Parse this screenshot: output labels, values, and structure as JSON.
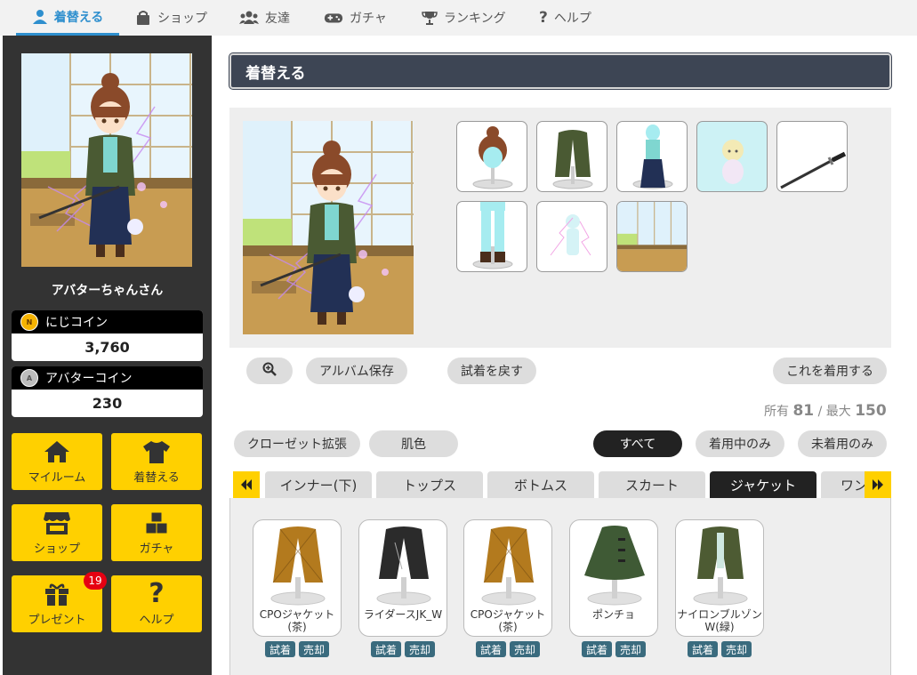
{
  "nav": [
    {
      "label": "着替える",
      "icon": "user-icon"
    },
    {
      "label": "ショップ",
      "icon": "bag-icon"
    },
    {
      "label": "友達",
      "icon": "friends-icon"
    },
    {
      "label": "ガチャ",
      "icon": "gamepad-icon"
    },
    {
      "label": "ランキング",
      "icon": "trophy-icon"
    },
    {
      "label": "ヘルプ",
      "icon": "question-icon"
    }
  ],
  "sidebar": {
    "user_name": "アバターちゃんさん",
    "coins": [
      {
        "label": "にじコイン",
        "value": "3,760",
        "badge": "nijicoin-icon",
        "color": "#f5b301"
      },
      {
        "label": "アバターコイン",
        "value": "230",
        "badge": "avatarcoin-icon",
        "color": "#bdbdbd"
      }
    ],
    "buttons": [
      {
        "label": "マイルーム",
        "icon": "home-icon"
      },
      {
        "label": "着替える",
        "icon": "tshirt-icon"
      },
      {
        "label": "ショップ",
        "icon": "shop-icon"
      },
      {
        "label": "ガチャ",
        "icon": "boxes-icon"
      },
      {
        "label": "プレゼント",
        "icon": "gift-icon"
      },
      {
        "label": "ヘルプ",
        "icon": "question-icon"
      }
    ],
    "present_badge": "19"
  },
  "page_title": "着替える",
  "equipped_thumbs": [
    "hair",
    "jacket",
    "hakama",
    "pet",
    "sword",
    "pants-boots",
    "effect",
    "background"
  ],
  "actions": {
    "zoom_label": "",
    "album_save": "アルバム保存",
    "undo_tryon": "試着を戻す",
    "wear_this": "これを着用する"
  },
  "owned": {
    "owned_label": "所有",
    "owned_count": "81",
    "separator": "/",
    "max_label": "最大",
    "max_count": "150"
  },
  "filters": {
    "closet_expand": "クローゼット拡張",
    "skin_color": "肌色",
    "all": "すべて",
    "wearing": "着用中のみ",
    "not_wearing": "未着用のみ"
  },
  "tabs": [
    "インナー(下)",
    "トップス",
    "ボトムス",
    "スカート",
    "ジャケット",
    "ワンピ"
  ],
  "active_tab": "ジャケット",
  "items": [
    {
      "name": "CPOジャケット(茶)",
      "color": "#b37a1e",
      "try": "試着",
      "sell": "売却"
    },
    {
      "name": "ライダースJK_W",
      "color": "#2b2b2b",
      "try": "試着",
      "sell": "売却"
    },
    {
      "name": "CPOジャケット(茶)",
      "color": "#b37a1e",
      "try": "試着",
      "sell": "売却"
    },
    {
      "name": "ポンチョ",
      "color": "#3f5a35",
      "try": "試着",
      "sell": "売却"
    },
    {
      "name": "ナイロンブルゾンW(緑)",
      "color": "#4d5b33",
      "try": "試着",
      "sell": "売却"
    }
  ],
  "colors": {
    "accent": "#ffd000",
    "nav_active": "#2e8fce",
    "header": "#3d4554",
    "sidebar": "#333333",
    "item_button": "#3a6b7e"
  }
}
